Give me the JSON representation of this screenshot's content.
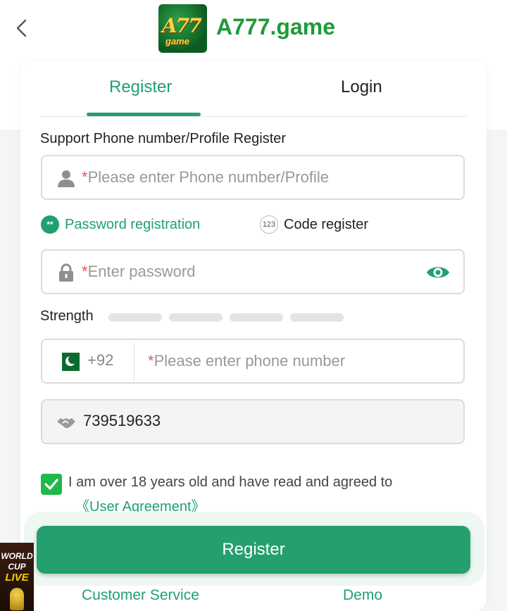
{
  "header": {
    "brand_name": "A777.game",
    "logo_text_big": "A77",
    "logo_text_small": "game",
    "back_icon": "chevron-left-icon"
  },
  "tabs": [
    {
      "label": "Register",
      "active": true
    },
    {
      "label": "Login",
      "active": false
    }
  ],
  "form": {
    "account_label": "Support Phone number/Profile Register",
    "account_placeholder": "Please enter Phone number/Profile",
    "required_mark": "*",
    "reg_options": [
      {
        "label": "Password registration",
        "icon_text": "**",
        "selected": true
      },
      {
        "label": "Code register",
        "icon_text": "123",
        "selected": false
      }
    ],
    "password_placeholder": "Enter password",
    "strength_label": "Strength",
    "country_code": "+92",
    "phone_placeholder": "Please enter phone number",
    "invite_code": "739519633",
    "agreement_text": "I am over 18 years old and have read and agreed to",
    "agreement_link": "《User Agreement》",
    "agreement_checked": true
  },
  "register_button": "Register",
  "footer": {
    "customer_service": "Customer Service",
    "demo": "Demo"
  },
  "promo": {
    "line1": "WORLD",
    "line2": "CUP",
    "line3": "LIVE"
  },
  "colors": {
    "accent": "#21a06f",
    "brand": "#1e9a3a",
    "checkbox": "#1fb84a",
    "required": "#e35454"
  }
}
